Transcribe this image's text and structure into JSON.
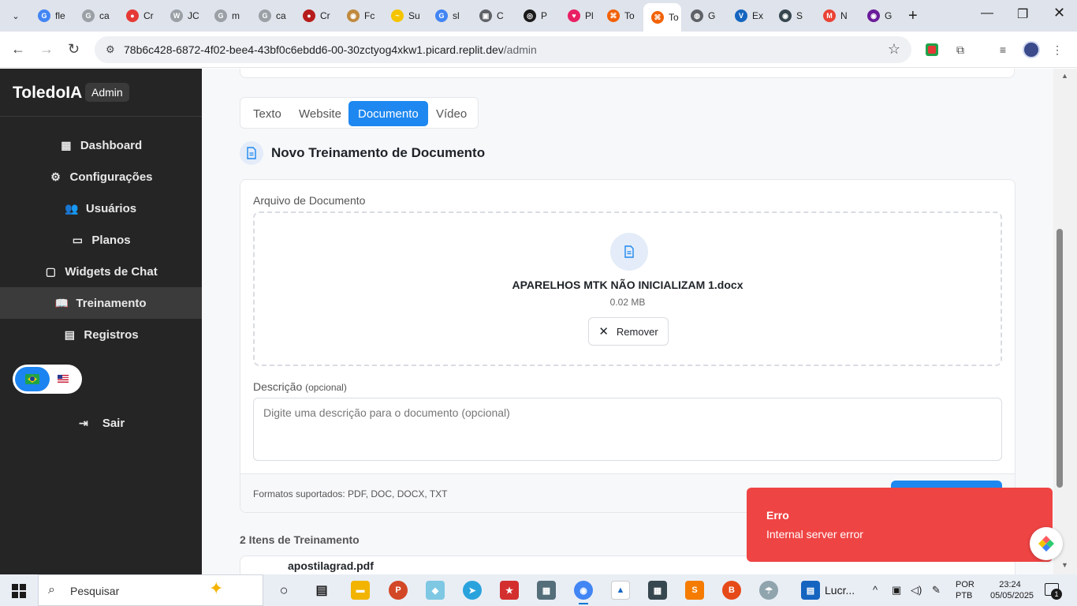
{
  "browser": {
    "tabs": [
      {
        "icon": "google-icon",
        "label": "fle",
        "color": "#4285f4",
        "glyph": "G"
      },
      {
        "icon": "google-icon",
        "label": "ca",
        "color": "#9aa0a6",
        "glyph": "G"
      },
      {
        "icon": "red-app-icon",
        "label": "Cr",
        "color": "#e53935",
        "glyph": "●"
      },
      {
        "icon": "wix-icon",
        "label": "JC",
        "color": "#9aa0a6",
        "glyph": "W"
      },
      {
        "icon": "google-icon",
        "label": "m",
        "color": "#9aa0a6",
        "glyph": "G"
      },
      {
        "icon": "google-icon",
        "label": "ca",
        "color": "#9aa0a6",
        "glyph": "G"
      },
      {
        "icon": "red-app-icon",
        "label": "Cr",
        "color": "#b71c1c",
        "glyph": "●"
      },
      {
        "icon": "food-icon",
        "label": "Fc",
        "color": "#c08a3e",
        "glyph": "◉"
      },
      {
        "icon": "wave-icon",
        "label": "Su",
        "color": "#f5c400",
        "glyph": "~"
      },
      {
        "icon": "google-icon",
        "label": "sl",
        "color": "#4285f4",
        "glyph": "G"
      },
      {
        "icon": "screen-icon",
        "label": "C",
        "color": "#5f6368",
        "glyph": "▣"
      },
      {
        "icon": "openai-icon",
        "label": "P",
        "color": "#1a1a1a",
        "glyph": "◎"
      },
      {
        "icon": "heart-icon",
        "label": "Pl",
        "color": "#e91e63",
        "glyph": "♥"
      },
      {
        "icon": "replit-icon",
        "label": "To",
        "color": "#f26207",
        "glyph": "⌘"
      },
      {
        "icon": "replit-icon",
        "label": "To",
        "color": "#f26207",
        "glyph": "⌘",
        "active": true
      },
      {
        "icon": "globe-icon",
        "label": "G",
        "color": "#5f6368",
        "glyph": "◍"
      },
      {
        "icon": "vt-icon",
        "label": "Ex",
        "color": "#1565c0",
        "glyph": "V"
      },
      {
        "icon": "shield-icon",
        "label": "S",
        "color": "#37474f",
        "glyph": "◉"
      },
      {
        "icon": "gmail-icon",
        "label": "N",
        "color": "#ea4335",
        "glyph": "M"
      },
      {
        "icon": "eye-icon",
        "label": "G",
        "color": "#6a1b9a",
        "glyph": "◉"
      }
    ],
    "url_host": "78b6c428-6872-4f02-bee4-43bf0c6ebdd6-00-30zctyog4xkw1.picard.replit.dev",
    "url_path": "/admin"
  },
  "sidebar": {
    "brand": "ToledoIA",
    "badge": "Admin",
    "items": [
      {
        "label": "Dashboard",
        "icon": "grid-icon",
        "glyph": "▦"
      },
      {
        "label": "Configurações",
        "icon": "gear-icon",
        "glyph": "⚙"
      },
      {
        "label": "Usuários",
        "icon": "users-icon",
        "glyph": "👥"
      },
      {
        "label": "Planos",
        "icon": "credit-card-icon",
        "glyph": "▭"
      },
      {
        "label": "Widgets de Chat",
        "icon": "message-icon",
        "glyph": "▢"
      },
      {
        "label": "Treinamento",
        "icon": "book-icon",
        "glyph": "📖",
        "active": true
      },
      {
        "label": "Registros",
        "icon": "file-text-icon",
        "glyph": "▤"
      }
    ],
    "logout": "Sair"
  },
  "main": {
    "tabs": [
      "Texto",
      "Website",
      "Documento",
      "Vídeo"
    ],
    "active_tab": "Documento",
    "section_title": "Novo Treinamento de Documento",
    "file_label": "Arquivo de Documento",
    "file_name": "APARELHOS MTK NÃO INICIALIZAM 1.docx",
    "file_size": "0.02 MB",
    "remove_label": "Remover",
    "desc_label": "Descrição",
    "desc_optional": "(opcional)",
    "desc_placeholder": "Digite uma descrição para o documento (opcional)",
    "formats": "Formatos suportados: PDF, DOC, DOCX, TXT",
    "items_title": "2 Itens de Treinamento",
    "first_item": "apostilagrad.pdf"
  },
  "toast": {
    "title": "Erro",
    "message": "Internal server error",
    "color": "#ef4444"
  },
  "taskbar": {
    "search_placeholder": "Pesquisar",
    "pinned_label": "Lucr...",
    "lang_line1": "POR",
    "lang_line2": "PTB",
    "time": "23:24",
    "date": "05/05/2025",
    "notif_count": "1"
  }
}
